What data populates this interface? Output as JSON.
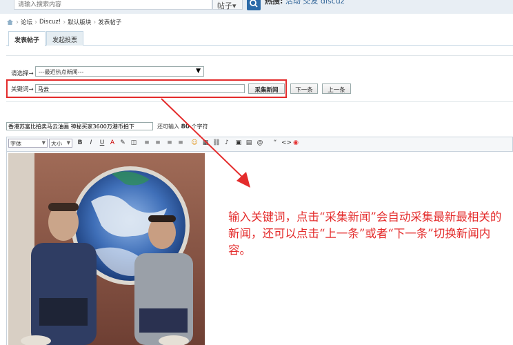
{
  "search": {
    "placeholder": "请输入搜索内容",
    "type": "帖子",
    "type_arrow": "▾"
  },
  "hot_words": {
    "label": "热搜:",
    "items": [
      "活动",
      "交友",
      "discuz"
    ]
  },
  "breadcrumb": [
    "论坛",
    "Discuz!",
    "默认版块",
    "发表帖子"
  ],
  "tabs": [
    {
      "label": "发表帖子",
      "active": true
    },
    {
      "label": "发起投票",
      "active": false
    }
  ],
  "collector": {
    "select_label": "请选择→",
    "select_value": "---最近热点新闻---",
    "keyword_label": "关键词→",
    "keyword_value": "马云",
    "collect_button": "采集新闻",
    "next_button": "下一条",
    "prev_button": "上一条"
  },
  "post": {
    "title_value": "香港苏富比拍卖马云油画 神秘买家3600万港币拍下",
    "counter_prefix": "还可输入",
    "counter_value": "80",
    "counter_suffix": "个字符"
  },
  "editor": {
    "font_select": "字体",
    "size_select": "大小",
    "buttons": [
      "B",
      "I",
      "U",
      "A",
      "✎",
      "◫",
      "≡",
      "≡",
      "≡",
      "≡",
      "☺",
      "▦",
      "⛓",
      "♪",
      "▣",
      "▤",
      "@",
      "“",
      "<>",
      "◉"
    ]
  },
  "annotation": "输入关键词，点击“采集新闻”会自动采集最新最相关的新闻，还可以点击“上一条”或者“下一条”切换新闻内容。",
  "colors": {
    "accent_red": "#e42c2c",
    "tab_border": "#c2d5e3",
    "search_btn": "#2b6aa8"
  }
}
